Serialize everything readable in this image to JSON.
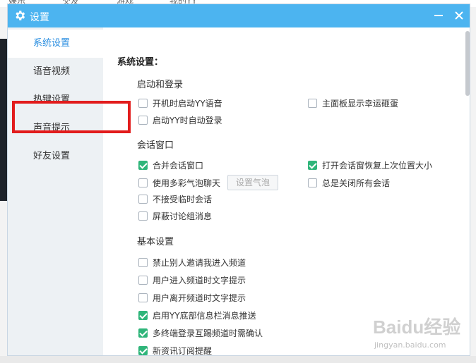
{
  "background": {
    "tabs": [
      "娱乐",
      "交友",
      "游戏",
      "我的YY"
    ]
  },
  "dialog": {
    "title": "设置",
    "icons": {
      "settings": "gear-icon",
      "minimize": "minimize-icon",
      "close": "close-icon"
    }
  },
  "sidebar": {
    "items": [
      {
        "label": "系统设置",
        "active": true
      },
      {
        "label": "语音视频",
        "active": false
      },
      {
        "label": "热键设置",
        "active": false
      },
      {
        "label": "声音提示",
        "active": false
      },
      {
        "label": "好友设置",
        "active": false
      }
    ]
  },
  "content": {
    "section_title": "系统设置：",
    "groups": {
      "startup": {
        "title": "启动和登录",
        "opt_autostart": {
          "label": "开机时启动YY语音",
          "checked": false
        },
        "opt_autologin": {
          "label": "启动YY时自动登录",
          "checked": false
        },
        "opt_lucky_egg": {
          "label": "主面板显示幸运砸蛋",
          "checked": false
        }
      },
      "chat_window": {
        "title": "会话窗口",
        "opt_merge": {
          "label": "合并会话窗口",
          "checked": true
        },
        "opt_bubble": {
          "label": "使用多彩气泡聊天",
          "checked": false
        },
        "opt_no_temp": {
          "label": "不接受临时会话",
          "checked": false
        },
        "opt_block_group": {
          "label": "屏蔽讨论组消息",
          "checked": false
        },
        "opt_restore_pos": {
          "label": "打开会话窗恢复上次位置大小",
          "checked": true
        },
        "opt_close_all": {
          "label": "总是关闭所有会话",
          "checked": false
        },
        "bubble_button": "设置气泡"
      },
      "basic": {
        "title": "基本设置",
        "opt_block_invite": {
          "label": "禁止别人邀请我进入频道",
          "checked": false
        },
        "opt_enter_hint": {
          "label": "用户进入频道时文字提示",
          "checked": false
        },
        "opt_leave_hint": {
          "label": "用户离开频道时文字提示",
          "checked": false
        },
        "opt_push": {
          "label": "启用YY底部信息栏消息推送",
          "checked": true
        },
        "opt_kick_confirm": {
          "label": "多终端登录互踢频道时需确认",
          "checked": true
        },
        "opt_subscribe": {
          "label": "新资讯订阅提醒",
          "checked": true
        }
      }
    }
  },
  "watermark": {
    "main": "Baidu经验",
    "sub": "jingyan.baidu.com"
  },
  "colors": {
    "titlebar": "#4cb4f0",
    "accent": "#2a8ee0",
    "checkbox": "#2fb57a",
    "highlight": "#e21c1c"
  }
}
